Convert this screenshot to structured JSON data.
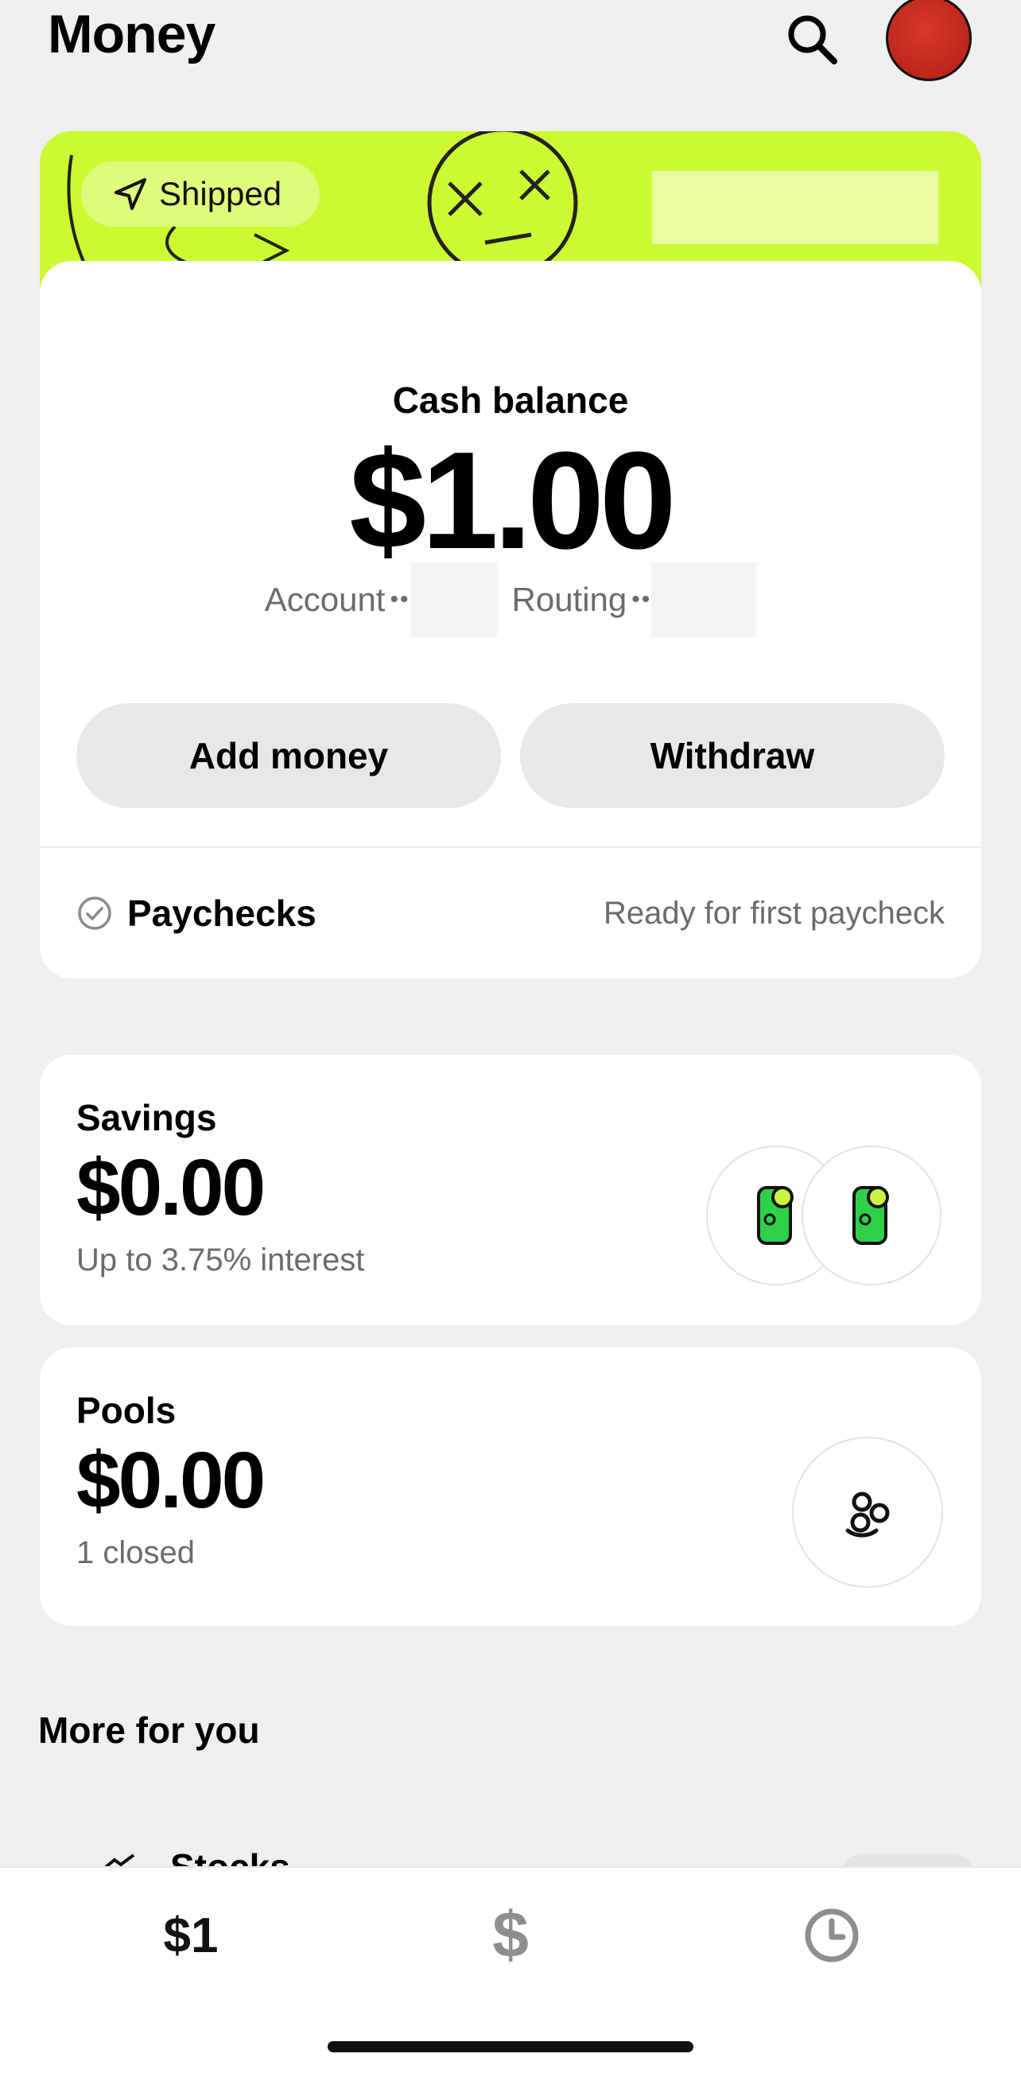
{
  "header": {
    "title": "Money"
  },
  "banner": {
    "status_label": "Shipped"
  },
  "cash": {
    "label": "Cash balance",
    "amount": "$1.00",
    "account_label": "Account",
    "routing_label": "Routing",
    "masked_dots": "••",
    "add_money_label": "Add money",
    "withdraw_label": "Withdraw",
    "paychecks_label": "Paychecks",
    "paychecks_status": "Ready for first paycheck"
  },
  "savings": {
    "label": "Savings",
    "amount": "$0.00",
    "subtitle": "Up to 3.75% interest"
  },
  "pools": {
    "label": "Pools",
    "amount": "$0.00",
    "subtitle": "1 closed"
  },
  "more": {
    "title": "More for you",
    "peek_item": "Stocks"
  },
  "tabbar": {
    "balance_label": "$1",
    "pay_label": "$"
  },
  "colors": {
    "banner": "#ccfa32",
    "avatar": "#c9271b",
    "money_green": "#2fd14a"
  }
}
